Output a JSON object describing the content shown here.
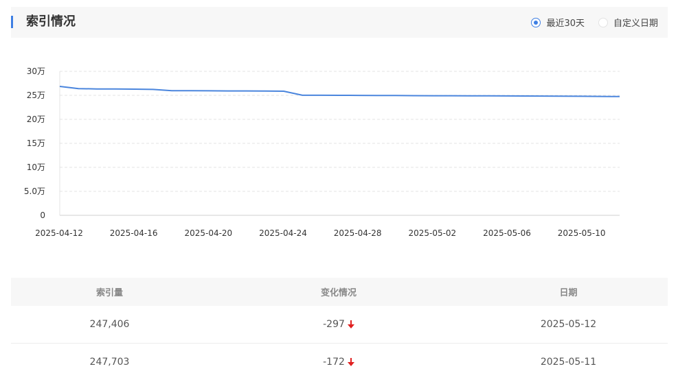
{
  "header": {
    "title": "索引情况",
    "range_options": [
      {
        "label": "最近30天",
        "selected": true
      },
      {
        "label": "自定义日期",
        "selected": false
      }
    ]
  },
  "colors": {
    "accent": "#3e7fe3",
    "line": "#4a85dd",
    "decrease": "#e02020"
  },
  "chart_data": {
    "type": "line",
    "x_tick_labels": [
      "2025-04-12",
      "2025-04-16",
      "2025-04-20",
      "2025-04-24",
      "2025-04-28",
      "2025-05-02",
      "2025-05-06",
      "2025-05-10"
    ],
    "y_tick_labels": [
      "0",
      "5.0万",
      "10万",
      "15万",
      "20万",
      "25万",
      "30万"
    ],
    "ylim": [
      0,
      300000
    ],
    "grid": true,
    "series": [
      {
        "x": [
          "2025-04-12",
          "2025-04-13",
          "2025-04-14",
          "2025-04-15",
          "2025-04-16",
          "2025-04-17",
          "2025-04-18",
          "2025-04-19",
          "2025-04-20",
          "2025-04-21",
          "2025-04-22",
          "2025-04-23",
          "2025-04-24",
          "2025-04-25",
          "2025-04-26",
          "2025-04-27",
          "2025-04-28",
          "2025-04-29",
          "2025-04-30",
          "2025-05-01",
          "2025-05-02",
          "2025-05-03",
          "2025-05-04",
          "2025-05-05",
          "2025-05-06",
          "2025-05-07",
          "2025-05-08",
          "2025-05-09",
          "2025-05-10",
          "2025-05-11",
          "2025-05-12"
        ],
        "values": [
          268500,
          264000,
          263300,
          263200,
          262800,
          262300,
          259600,
          259600,
          259400,
          259200,
          259100,
          258900,
          258600,
          250200,
          250100,
          250000,
          249800,
          249700,
          249500,
          249300,
          249200,
          249100,
          248900,
          248800,
          248700,
          248600,
          248400,
          248200,
          248000,
          247703,
          247406
        ]
      }
    ]
  },
  "table": {
    "headers": [
      "索引量",
      "变化情况",
      "日期"
    ],
    "rows": [
      {
        "count": "247,406",
        "change": "-297",
        "date": "2025-05-12"
      },
      {
        "count": "247,703",
        "change": "-172",
        "date": "2025-05-11"
      }
    ]
  }
}
